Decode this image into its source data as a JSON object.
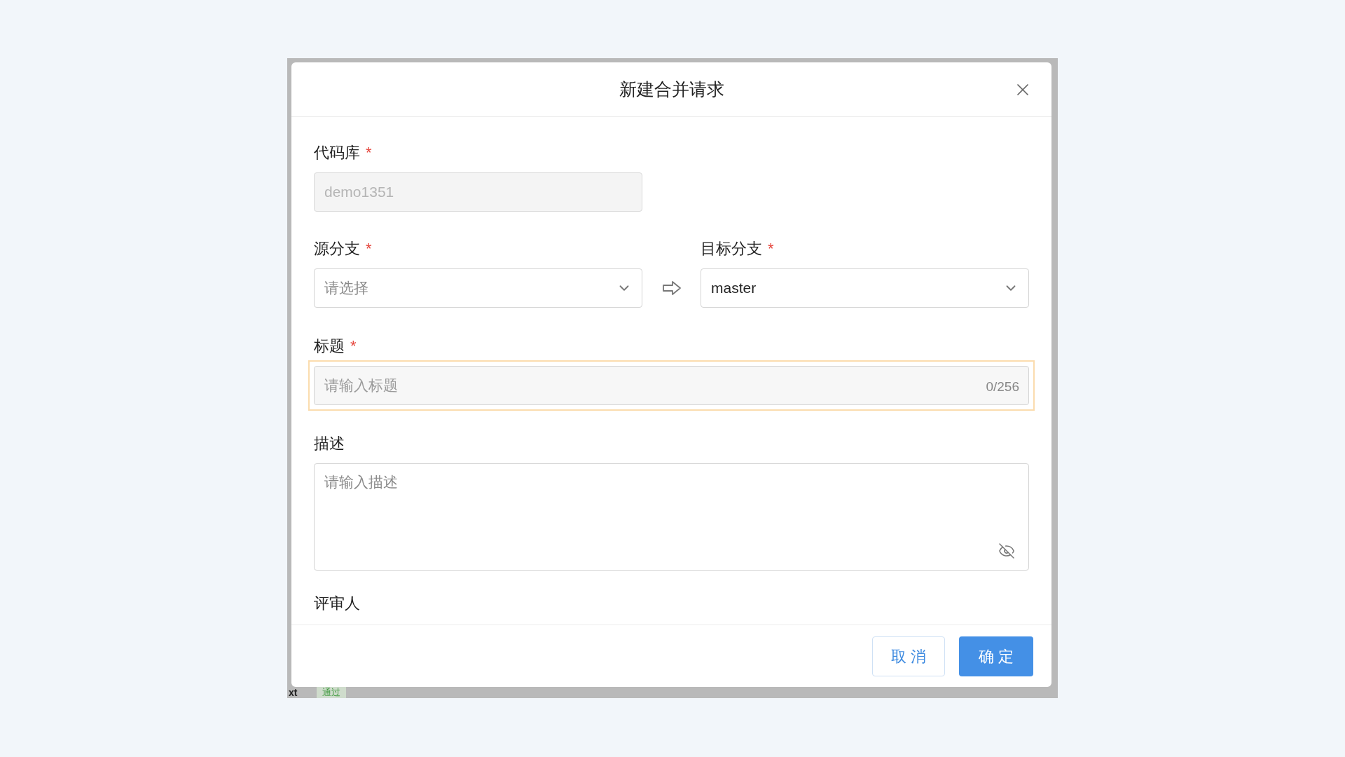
{
  "background": {
    "row_text": "xt",
    "status_tag": "通过"
  },
  "dialog": {
    "title": "新建合并请求",
    "repository": {
      "label": "代码库",
      "required_mark": "*",
      "value": "demo1351",
      "disabled": true
    },
    "source_branch": {
      "label": "源分支",
      "required_mark": "*",
      "placeholder": "请选择"
    },
    "target_branch": {
      "label": "目标分支",
      "required_mark": "*",
      "value": "master"
    },
    "title_field": {
      "label": "标题",
      "required_mark": "*",
      "placeholder": "请输入标题",
      "counter": "0/256",
      "highlighted": true
    },
    "description": {
      "label": "描述",
      "placeholder": "请输入描述"
    },
    "reviewers": {
      "label": "评审人"
    },
    "buttons": [
      {
        "label": "取 消",
        "kind": "secondary"
      },
      {
        "label": "确 定",
        "kind": "primary"
      }
    ]
  }
}
